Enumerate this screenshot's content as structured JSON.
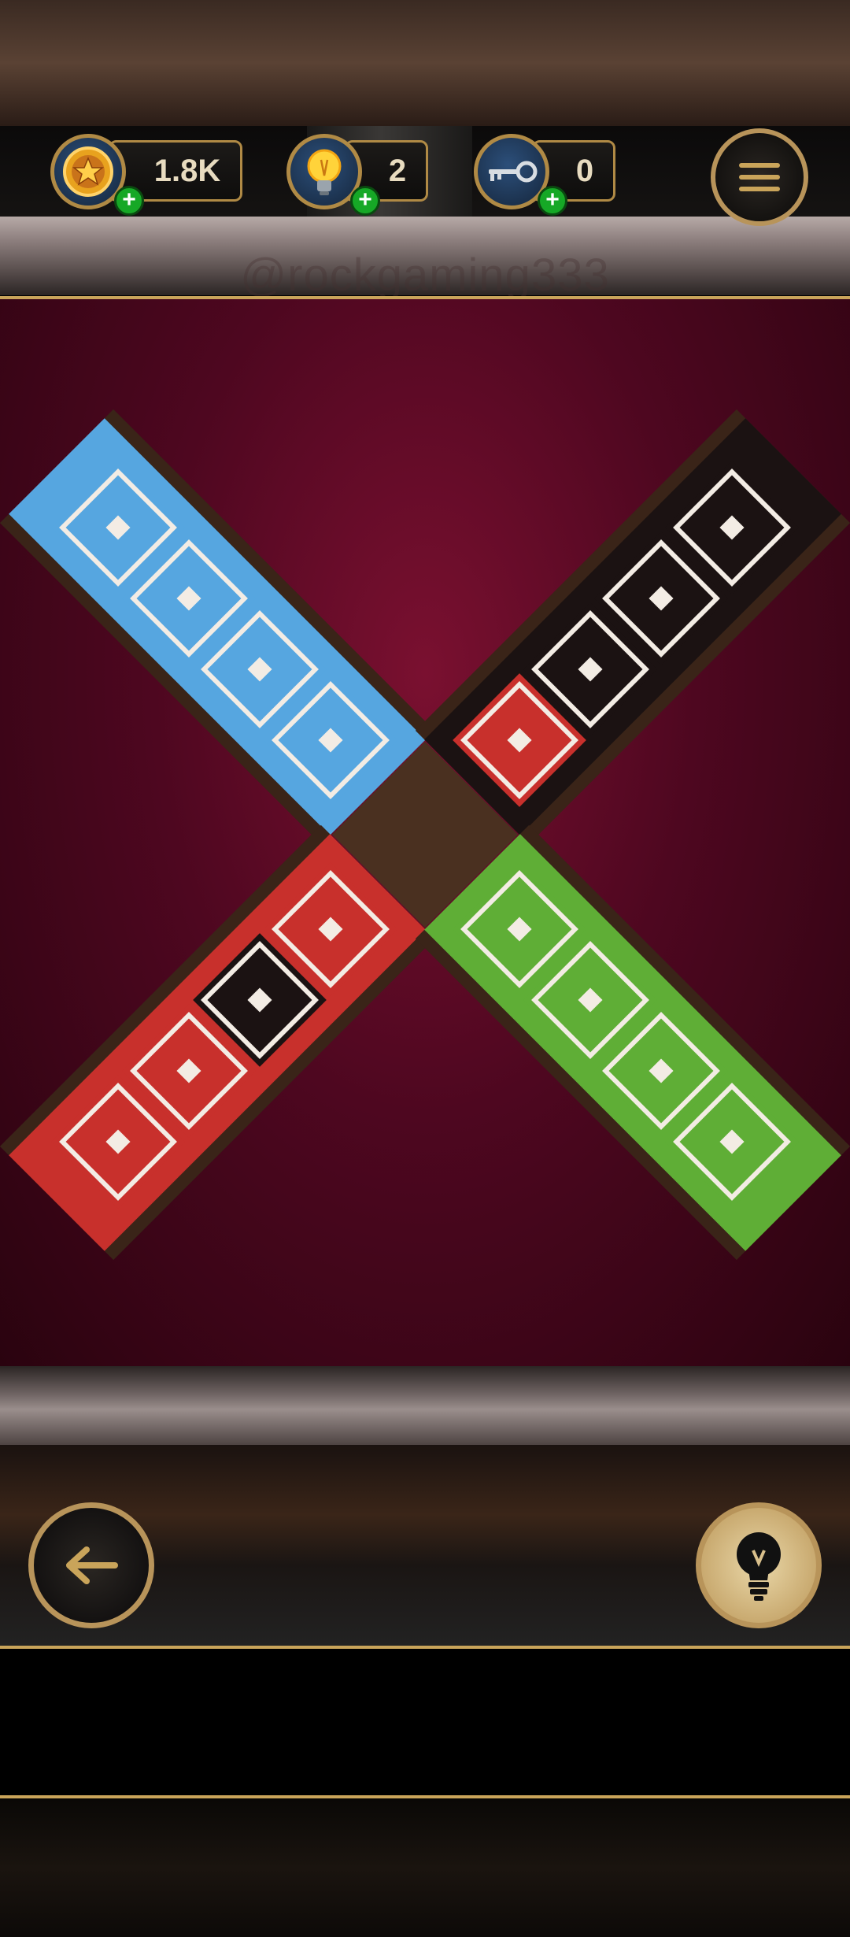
{
  "hud": {
    "coins": {
      "value": "1.8K",
      "icon": "star-coin-icon"
    },
    "hints": {
      "value": "2",
      "icon": "lightbulb-icon"
    },
    "keys": {
      "value": "0",
      "icon": "key-icon"
    },
    "add_icon": "plus-icon",
    "menu_icon": "hamburger-menu-icon"
  },
  "watermark": "@rockgaming333",
  "board": {
    "arms": [
      {
        "name": "top-left",
        "color": "#56a6e0",
        "tiles": [
          "blue",
          "blue",
          "blue",
          "blue"
        ]
      },
      {
        "name": "top-right",
        "color": "#1b1212",
        "tiles": [
          "red",
          "black",
          "black",
          "black"
        ]
      },
      {
        "name": "bottom-left",
        "color": "#c8302c",
        "tiles": [
          "red",
          "black",
          "red",
          "red"
        ]
      },
      {
        "name": "bottom-right",
        "color": "#5fae36",
        "tiles": [
          "green",
          "green",
          "green",
          "green"
        ]
      }
    ],
    "tile_colors": {
      "blue": "#56a6e0",
      "red": "#c8302c",
      "black": "#1b1212",
      "green": "#5fae36"
    }
  },
  "controls": {
    "back_icon": "arrow-left-icon",
    "hint_icon": "lightbulb-icon"
  },
  "colors": {
    "gold": "#c9a45a",
    "board_bg": "#4e0720"
  }
}
